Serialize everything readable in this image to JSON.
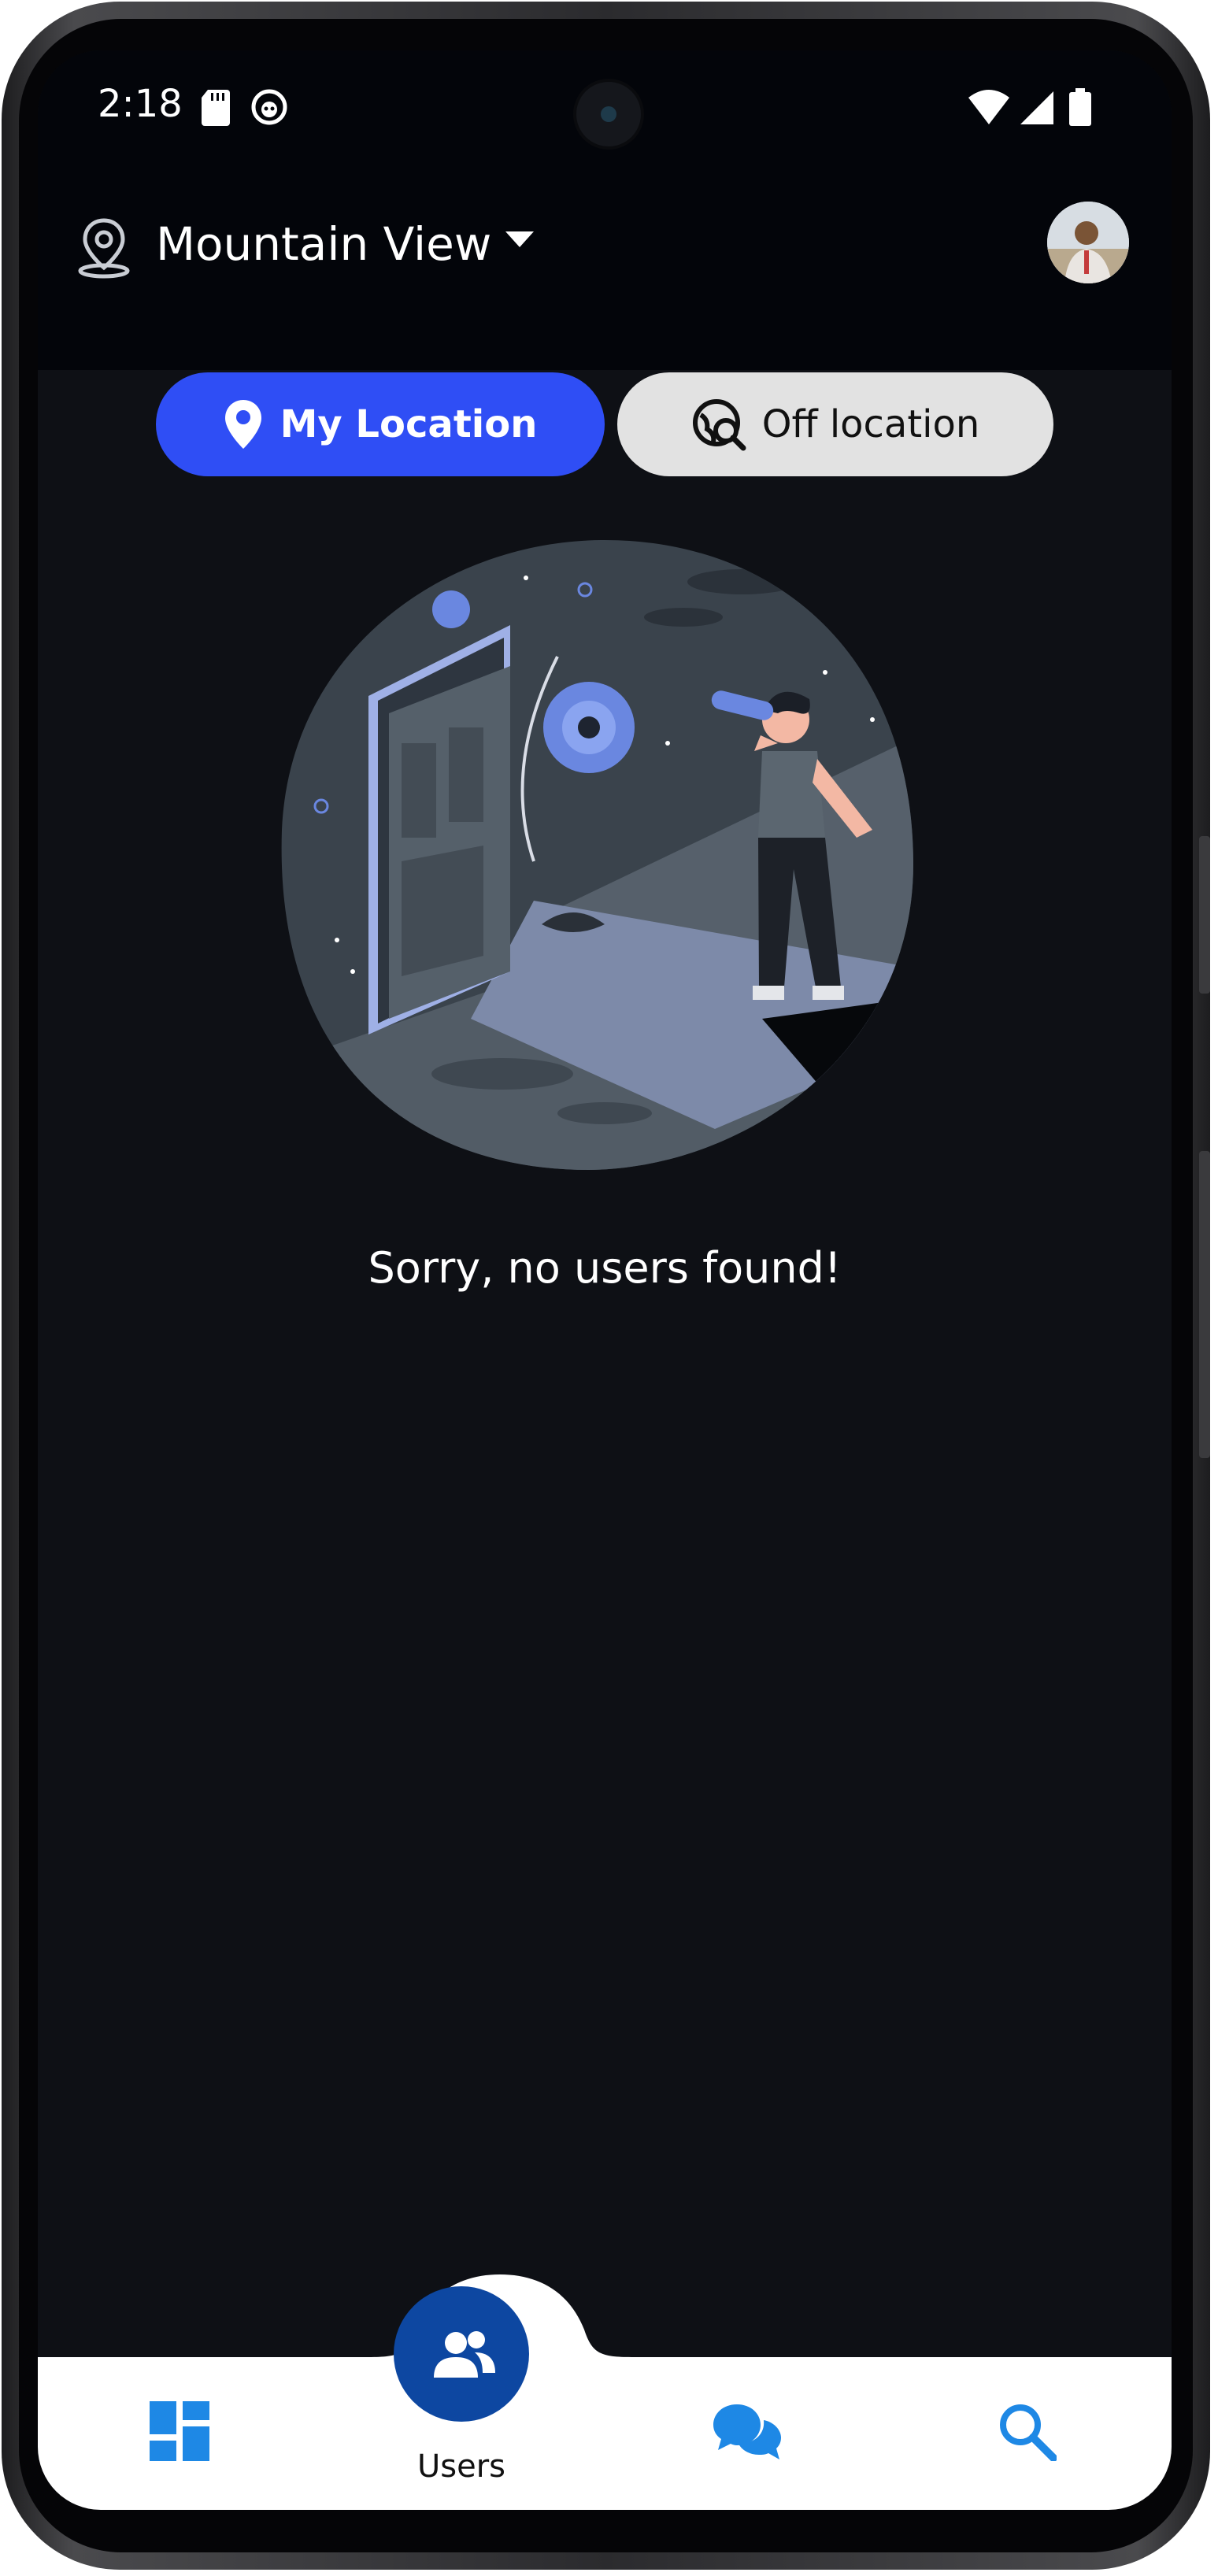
{
  "status_bar": {
    "time": "2:18",
    "icons": [
      "sd-card-icon",
      "app-notification-icon",
      "wifi-icon",
      "signal-icon",
      "battery-icon"
    ]
  },
  "header": {
    "location_icon": "location-pin-icon",
    "city": "Mountain View",
    "dropdown_icon": "chevron-down-icon",
    "avatar_icon": "user-avatar"
  },
  "filters": {
    "my_location": {
      "label": "My Location",
      "icon": "map-pin-icon",
      "active": true
    },
    "off_location": {
      "label": "Off location",
      "icon": "globe-search-icon",
      "active": false
    }
  },
  "empty_state": {
    "message": "Sorry, no users found!"
  },
  "bottom_nav": {
    "items": [
      {
        "icon": "dashboard-icon",
        "label": ""
      },
      {
        "icon": "users-icon",
        "label": "Users",
        "active": true
      },
      {
        "icon": "chat-icon",
        "label": ""
      },
      {
        "icon": "search-icon",
        "label": ""
      }
    ]
  },
  "colors": {
    "accent": "#2f4ef5",
    "nav_active": "#0d47a1",
    "nav_icon": "#1e88e5",
    "background": "#0e1015",
    "header": "#03050a"
  }
}
